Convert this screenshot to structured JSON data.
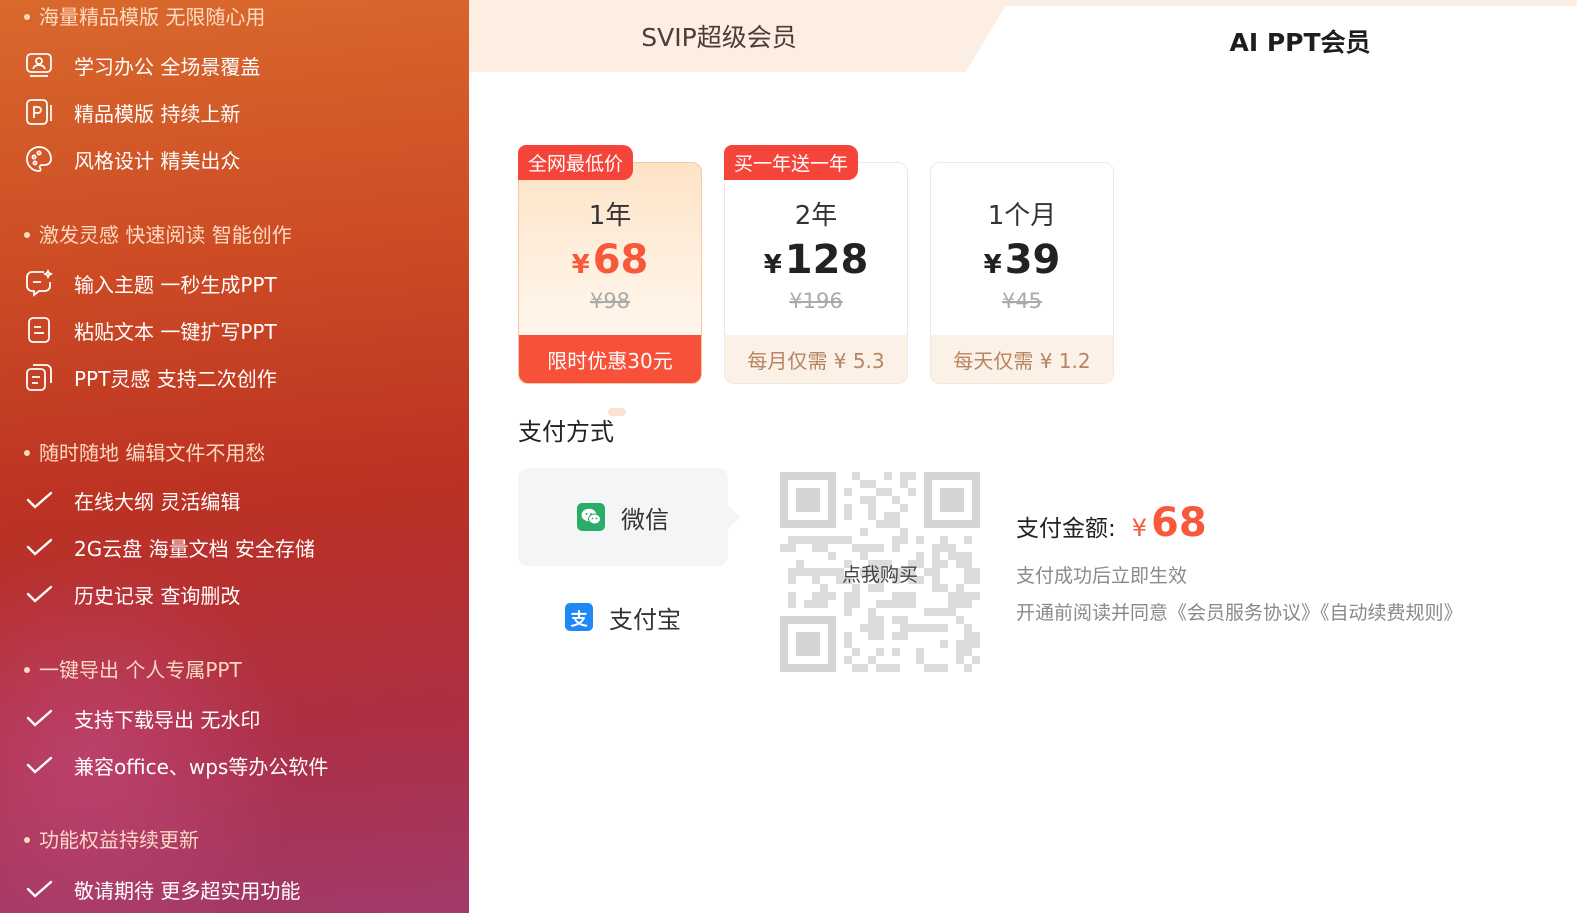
{
  "sidebar": {
    "sections": [
      {
        "title": "海量精品模版 无限随心用",
        "items": [
          {
            "icon": "person-card-icon",
            "label": "学习办公 全场景覆盖"
          },
          {
            "icon": "template-icon",
            "label": "精品模版 持续上新"
          },
          {
            "icon": "palette-icon",
            "label": "风格设计 精美出众"
          }
        ]
      },
      {
        "title": "激发灵感 快速阅读 智能创作",
        "items": [
          {
            "icon": "chat-sparkle-icon",
            "label": "输入主题 一秒生成PPT"
          },
          {
            "icon": "document-icon",
            "label": "粘贴文本 一键扩写PPT"
          },
          {
            "icon": "documents-icon",
            "label": "PPT灵感 支持二次创作"
          }
        ]
      },
      {
        "title": "随时随地 编辑文件不用愁",
        "items": [
          {
            "icon": "check-icon",
            "label": "在线大纲 灵活编辑"
          },
          {
            "icon": "check-icon",
            "label": "2G云盘 海量文档 安全存储"
          },
          {
            "icon": "check-icon",
            "label": "历史记录 查询删改"
          }
        ]
      },
      {
        "title": "一键导出 个人专属PPT",
        "items": [
          {
            "icon": "check-icon",
            "label": "支持下载导出 无水印"
          },
          {
            "icon": "check-icon",
            "label": "兼容office、wps等办公软件"
          }
        ]
      },
      {
        "title": "功能权益持续更新",
        "items": [
          {
            "icon": "check-icon",
            "label": "敬请期待 更多超实用功能"
          }
        ]
      }
    ]
  },
  "tabs": {
    "svip": "SVIP超级会员",
    "aippt": "AI PPT会员"
  },
  "plans": [
    {
      "badge": "全网最低价",
      "duration": "1年",
      "currency": "¥",
      "price": "68",
      "original": "¥98",
      "footer": "限时优惠30元",
      "selected": true
    },
    {
      "badge": "买一年送一年",
      "duration": "2年",
      "currency": "¥",
      "price": "128",
      "original": "¥196",
      "footer": "每月仅需 ¥ 5.3",
      "selected": false
    },
    {
      "badge": "",
      "duration": "1个月",
      "currency": "¥",
      "price": "39",
      "original": "¥45",
      "footer": "每天仅需 ¥ 1.2",
      "selected": false
    }
  ],
  "payment": {
    "title": "支付方式",
    "wechat": "微信",
    "alipay": "支付宝",
    "alipay_icon_glyph": "支",
    "qr_label": "点我购买",
    "amount_label": "支付金额:",
    "amount_currency": "¥",
    "amount_value": "68",
    "hint": "支付成功后立即生效",
    "agreement": "开通前阅读并同意《会员服务协议》《自动续费规则》"
  },
  "colors": {
    "accent": "#f7593a",
    "badge": "#f5453a",
    "wechat": "#2aae67",
    "alipay": "#1677ff"
  }
}
